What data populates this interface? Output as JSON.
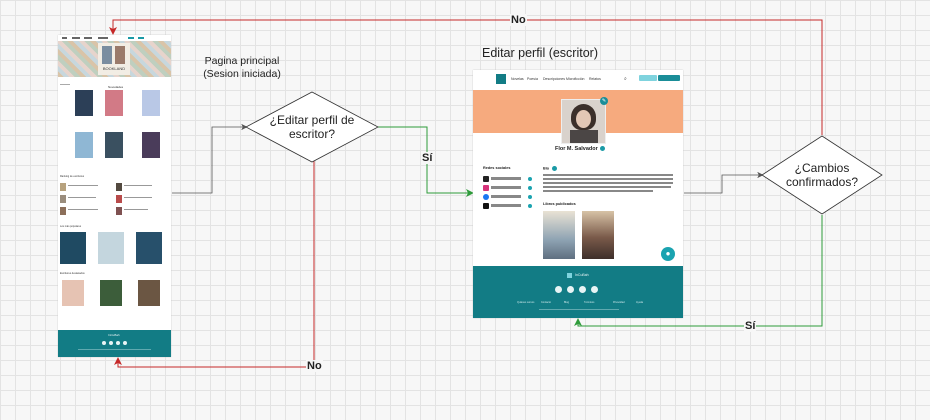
{
  "labels": {
    "pagina_principal": "Pagina principal\n(Sesion iniciada)",
    "editar_perfil": "Editar perfil (escritor)"
  },
  "decisions": {
    "editar": "¿Editar perfil de\nescritor?",
    "cambios": "¿Cambios\nconfirmados?"
  },
  "edge_labels": {
    "no_top": "No",
    "si_left": "Sí",
    "si_bottom": "Sí",
    "no_bottom": "No"
  },
  "colors": {
    "red": "#c62828",
    "green": "#2e9b3a",
    "gray": "#4a4a4a",
    "teal": "#127c85",
    "peach": "#f6aa7e"
  },
  "mock_main": {
    "banner_title": "BOOKLAND",
    "section_1": "Novedades",
    "section_2": "Libros",
    "section_3": "Ranking de escritores",
    "section_4": "Los más populares",
    "section_5": "Escritores destacados",
    "footer_brand": "InCuBah"
  },
  "mock_profile": {
    "nav": [
      "Novelas",
      "Poesía",
      "Descripciones",
      "Microficción",
      "Relatos"
    ],
    "name": "Flor M. Salvador",
    "social_heading": "Redes sociales",
    "bio_heading": "Bio",
    "books_heading": "Libros publicados",
    "footer_brand": "InCuBah",
    "footer_links": [
      "Quiénes somos",
      "Contacto",
      "Blog",
      "Términos",
      "Privacidad",
      "Ayuda"
    ],
    "icons": [
      "x-icon",
      "instagram-icon",
      "facebook-icon",
      "tiktok-icon",
      "chat-icon",
      "pencil-icon",
      "search-icon"
    ]
  }
}
